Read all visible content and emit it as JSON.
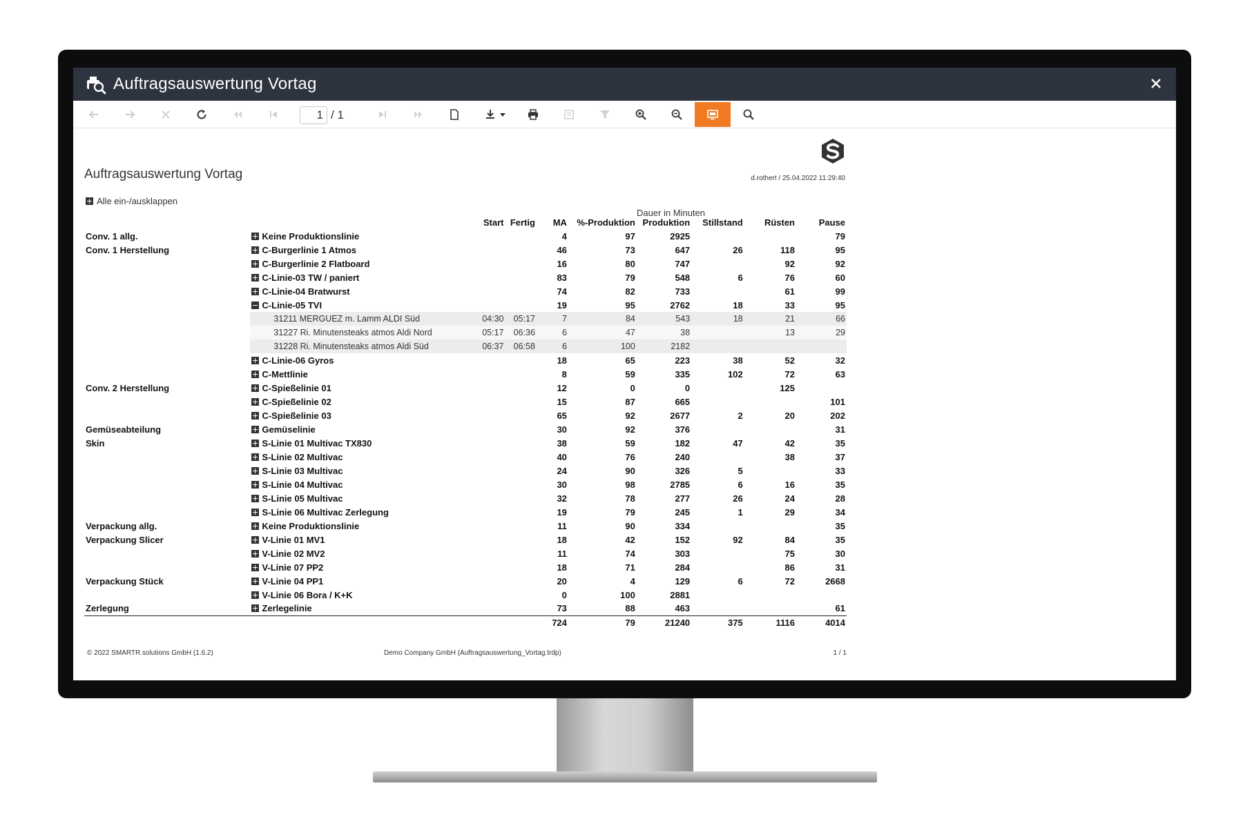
{
  "window": {
    "title": "Auftragsauswertung Vortag"
  },
  "toolbar": {
    "page_current": "1",
    "page_separator": "/ 1"
  },
  "report": {
    "title": "Auftragsauswertung Vortag",
    "user_stamp": "d.rothert / 25.04.2022 11:29:40",
    "toggle_all": "Alle ein-/ausklappen",
    "group_header": "Dauer in Minuten",
    "columns": {
      "start": "Start",
      "fertig": "Fertig",
      "ma": "MA",
      "prozent": "%-Produktion",
      "produktion": "Produktion",
      "stillstand": "Stillstand",
      "ruesten": "Rüsten",
      "pause": "Pause"
    },
    "rows": [
      {
        "type": "line",
        "dept": "Conv. 1 allg.",
        "name": "Keine Produktionslinie",
        "expanded": false,
        "ma": "4",
        "pct": "97",
        "low": false,
        "prod": "2925",
        "still": "",
        "ruest": "",
        "pause": "79"
      },
      {
        "type": "line",
        "dept": "Conv. 1 Herstellung",
        "name": "C-Burgerlinie 1 Atmos",
        "expanded": false,
        "ma": "46",
        "pct": "73",
        "low": true,
        "prod": "647",
        "still": "26",
        "ruest": "118",
        "pause": "95"
      },
      {
        "type": "line",
        "dept": "",
        "name": "C-Burgerlinie 2 Flatboard",
        "expanded": false,
        "ma": "16",
        "pct": "80",
        "low": false,
        "prod": "747",
        "still": "",
        "ruest": "92",
        "pause": "92"
      },
      {
        "type": "line",
        "dept": "",
        "name": "C-Linie-03 TW / paniert",
        "expanded": false,
        "ma": "83",
        "pct": "79",
        "low": true,
        "prod": "548",
        "still": "6",
        "ruest": "76",
        "pause": "60"
      },
      {
        "type": "line",
        "dept": "",
        "name": "C-Linie-04 Bratwurst",
        "expanded": false,
        "ma": "74",
        "pct": "82",
        "low": false,
        "prod": "733",
        "still": "",
        "ruest": "61",
        "pause": "99"
      },
      {
        "type": "line",
        "dept": "",
        "name": "C-Linie-05 TVI",
        "expanded": true,
        "ma": "19",
        "pct": "95",
        "low": false,
        "prod": "2762",
        "still": "18",
        "ruest": "33",
        "pause": "95"
      },
      {
        "type": "order",
        "dept": "",
        "name": "31211 MERGUEZ m. Lamm ALDI Süd",
        "start": "04:30",
        "fertig": "05:17",
        "ma": "7",
        "pct": "84",
        "low": false,
        "prod": "543",
        "still": "18",
        "ruest": "21",
        "pause": "66"
      },
      {
        "type": "order",
        "dept": "",
        "name": "31227 Ri. Minutensteaks atmos Aldi Nord",
        "start": "05:17",
        "fertig": "06:36",
        "ma": "6",
        "pct": "47",
        "low": true,
        "prod": "38",
        "still": "",
        "ruest": "13",
        "pause": "29"
      },
      {
        "type": "order",
        "dept": "",
        "name": "31228 Ri. Minutensteaks atmos Aldi Süd",
        "start": "06:37",
        "fertig": "06:58",
        "ma": "6",
        "pct": "100",
        "low": false,
        "prod": "2182",
        "still": "",
        "ruest": "",
        "pause": ""
      },
      {
        "type": "line",
        "dept": "",
        "name": "C-Linie-06 Gyros",
        "expanded": false,
        "ma": "18",
        "pct": "65",
        "low": true,
        "prod": "223",
        "still": "38",
        "ruest": "52",
        "pause": "32"
      },
      {
        "type": "line",
        "dept": "",
        "name": "C-Mettlinie",
        "expanded": false,
        "ma": "8",
        "pct": "59",
        "low": true,
        "prod": "335",
        "still": "102",
        "ruest": "72",
        "pause": "63"
      },
      {
        "type": "line",
        "dept": "Conv. 2 Herstellung",
        "name": "C-Spießelinie 01",
        "expanded": false,
        "ma": "12",
        "pct": "0",
        "low": true,
        "prod": "0",
        "still": "",
        "ruest": "125",
        "pause": ""
      },
      {
        "type": "line",
        "dept": "",
        "name": "C-Spießelinie 02",
        "expanded": false,
        "ma": "15",
        "pct": "87",
        "low": false,
        "prod": "665",
        "still": "",
        "ruest": "",
        "pause": "101"
      },
      {
        "type": "line",
        "dept": "",
        "name": "C-Spießelinie 03",
        "expanded": false,
        "ma": "65",
        "pct": "92",
        "low": false,
        "prod": "2677",
        "still": "2",
        "ruest": "20",
        "pause": "202"
      },
      {
        "type": "line",
        "dept": "Gemüseabteilung",
        "name": "Gemüselinie",
        "expanded": false,
        "ma": "30",
        "pct": "92",
        "low": false,
        "prod": "376",
        "still": "",
        "ruest": "",
        "pause": "31"
      },
      {
        "type": "line",
        "dept": "Skin",
        "name": "S-Linie 01 Multivac TX830",
        "expanded": false,
        "ma": "38",
        "pct": "59",
        "low": true,
        "prod": "182",
        "still": "47",
        "ruest": "42",
        "pause": "35"
      },
      {
        "type": "line",
        "dept": "",
        "name": "S-Linie 02 Multivac",
        "expanded": false,
        "ma": "40",
        "pct": "76",
        "low": true,
        "prod": "240",
        "still": "",
        "ruest": "38",
        "pause": "37"
      },
      {
        "type": "line",
        "dept": "",
        "name": "S-Linie 03 Multivac",
        "expanded": false,
        "ma": "24",
        "pct": "90",
        "low": false,
        "prod": "326",
        "still": "5",
        "ruest": "",
        "pause": "33"
      },
      {
        "type": "line",
        "dept": "",
        "name": "S-Linie 04 Multivac",
        "expanded": false,
        "ma": "30",
        "pct": "98",
        "low": false,
        "prod": "2785",
        "still": "6",
        "ruest": "16",
        "pause": "35"
      },
      {
        "type": "line",
        "dept": "",
        "name": "S-Linie 05 Multivac",
        "expanded": false,
        "ma": "32",
        "pct": "78",
        "low": true,
        "prod": "277",
        "still": "26",
        "ruest": "24",
        "pause": "28"
      },
      {
        "type": "line",
        "dept": "",
        "name": "S-Linie 06 Multivac Zerlegung",
        "expanded": false,
        "ma": "19",
        "pct": "79",
        "low": true,
        "prod": "245",
        "still": "1",
        "ruest": "29",
        "pause": "34"
      },
      {
        "type": "line",
        "dept": "Verpackung allg.",
        "name": "Keine Produktionslinie",
        "expanded": false,
        "ma": "11",
        "pct": "90",
        "low": false,
        "prod": "334",
        "still": "",
        "ruest": "",
        "pause": "35"
      },
      {
        "type": "line",
        "dept": "Verpackung Slicer",
        "name": "V-Linie 01 MV1",
        "expanded": false,
        "ma": "18",
        "pct": "42",
        "low": true,
        "prod": "152",
        "still": "92",
        "ruest": "84",
        "pause": "35"
      },
      {
        "type": "line",
        "dept": "",
        "name": "V-Linie 02 MV2",
        "expanded": false,
        "ma": "11",
        "pct": "74",
        "low": true,
        "prod": "303",
        "still": "",
        "ruest": "75",
        "pause": "30"
      },
      {
        "type": "line",
        "dept": "",
        "name": "V-Linie 07 PP2",
        "expanded": false,
        "ma": "18",
        "pct": "71",
        "low": true,
        "prod": "284",
        "still": "",
        "ruest": "86",
        "pause": "31"
      },
      {
        "type": "line",
        "dept": "Verpackung Stück",
        "name": "V-Linie 04 PP1",
        "expanded": false,
        "ma": "20",
        "pct": "4",
        "low": true,
        "prod": "129",
        "still": "6",
        "ruest": "72",
        "pause": "2668"
      },
      {
        "type": "line",
        "dept": "",
        "name": "V-Linie 06 Bora / K+K",
        "expanded": false,
        "ma": "0",
        "pct": "100",
        "low": false,
        "prod": "2881",
        "still": "",
        "ruest": "",
        "pause": ""
      },
      {
        "type": "line",
        "dept": "Zerlegung",
        "name": "Zerlegelinie",
        "expanded": false,
        "ma": "73",
        "pct": "88",
        "low": false,
        "prod": "463",
        "still": "",
        "ruest": "",
        "pause": "61"
      }
    ],
    "totals": {
      "ma": "724",
      "pct": "79",
      "low": true,
      "prod": "21240",
      "still": "375",
      "ruest": "1116",
      "pause": "4014"
    }
  },
  "footer": {
    "copyright": "© 2022 SMARTR.solutions GmbH (1.6.2)",
    "company": "Demo Company GmbH (Auftragsauswertung_Vortag.trdp)",
    "page": "1 / 1"
  },
  "colors": {
    "titlebar": "#2d333f",
    "accent": "#f07a21",
    "low_value": "#c0435f"
  }
}
